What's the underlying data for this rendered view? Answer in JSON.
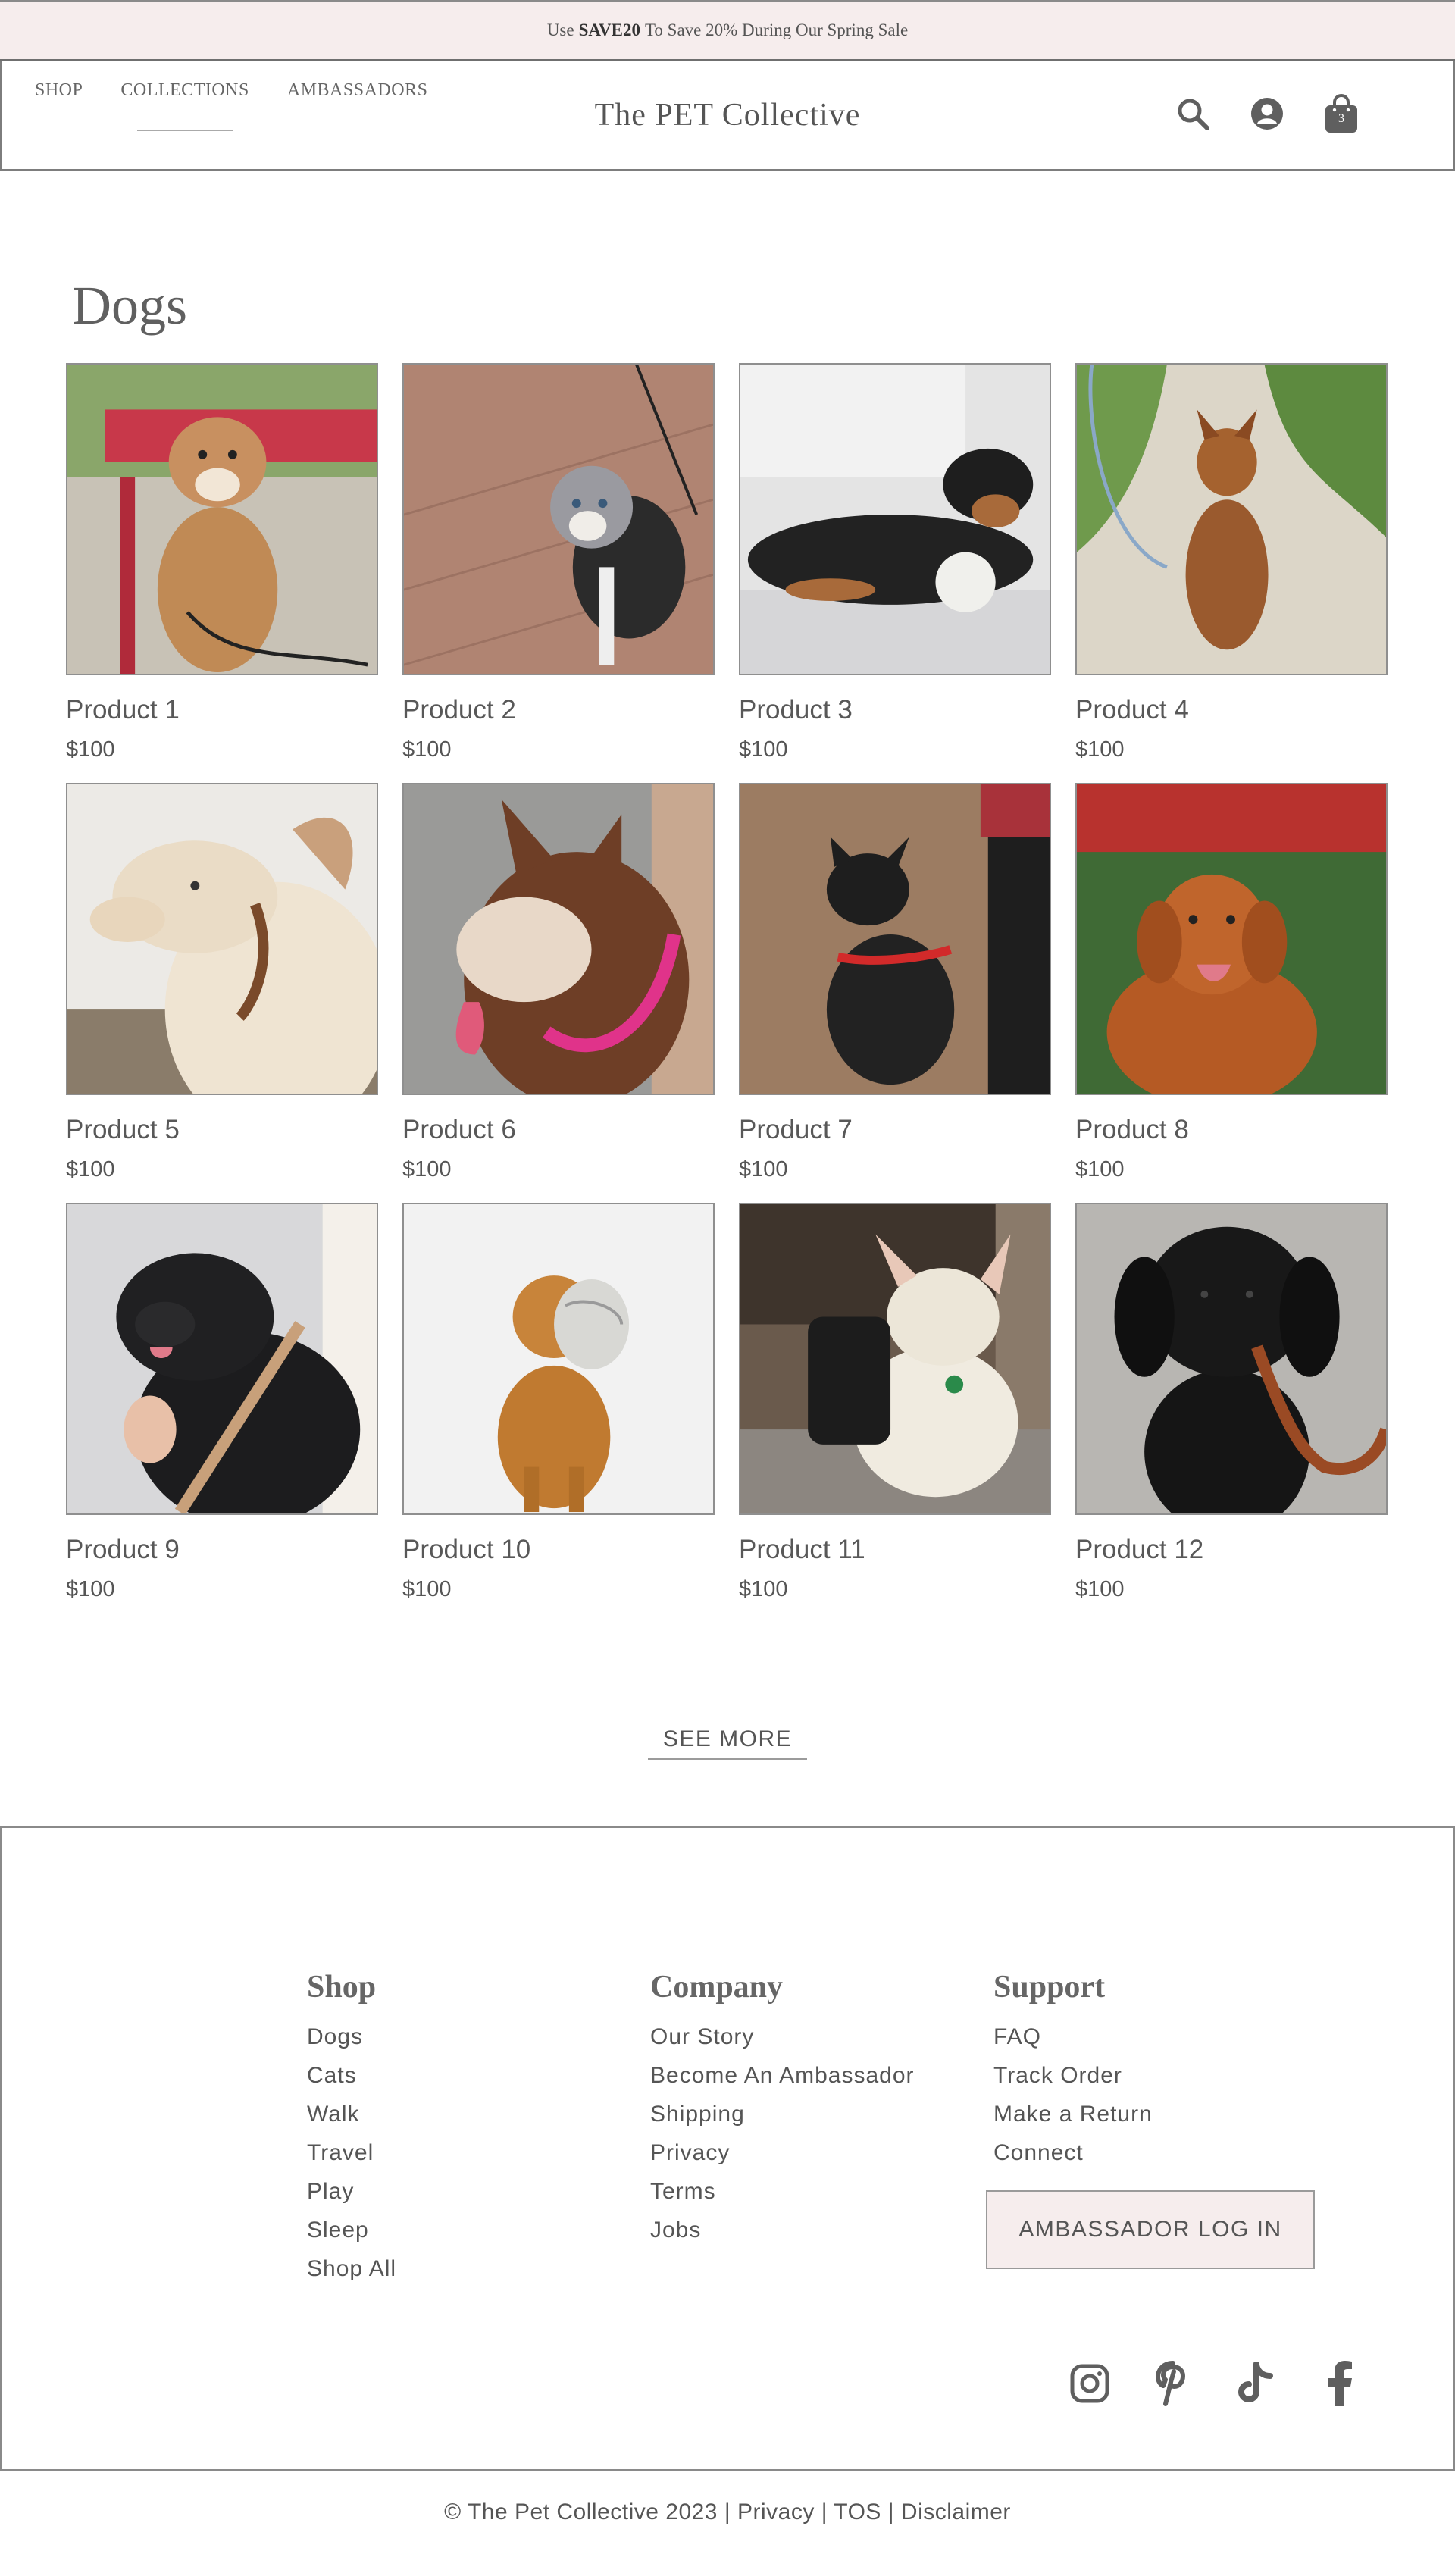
{
  "announcement": {
    "prefix": "Use",
    "code": "SAVE20",
    "suffix": "To Save 20% During Our Spring Sale"
  },
  "nav": {
    "items": [
      {
        "label": "SHOP"
      },
      {
        "label": "COLLECTIONS"
      },
      {
        "label": "AMBASSADORS"
      }
    ],
    "active": "COLLECTIONS"
  },
  "brand": "The PET Collective",
  "header_icons": [
    "search-icon",
    "account-icon",
    "cart-icon"
  ],
  "cart_count": "3",
  "page_title": "Dogs",
  "products": [
    {
      "name": "Product 1",
      "price": "$100"
    },
    {
      "name": "Product 2",
      "price": "$100"
    },
    {
      "name": "Product 3",
      "price": "$100"
    },
    {
      "name": "Product 4",
      "price": "$100"
    },
    {
      "name": "Product 5",
      "price": "$100"
    },
    {
      "name": "Product 6",
      "price": "$100"
    },
    {
      "name": "Product 7",
      "price": "$100"
    },
    {
      "name": "Product 8",
      "price": "$100"
    },
    {
      "name": "Product 9",
      "price": "$100"
    },
    {
      "name": "Product 10",
      "price": "$100"
    },
    {
      "name": "Product 11",
      "price": "$100"
    },
    {
      "name": "Product 12",
      "price": "$100"
    }
  ],
  "see_more": "SEE MORE",
  "footer": {
    "shop": {
      "title": "Shop",
      "links": [
        "Dogs",
        "Cats",
        "Walk",
        "Travel",
        "Play",
        "Sleep",
        "Shop All"
      ]
    },
    "company": {
      "title": "Company",
      "links": [
        "Our Story",
        "Become An Ambassador",
        "Shipping",
        "Privacy",
        "Terms",
        "Jobs"
      ]
    },
    "support": {
      "title": "Support",
      "links": [
        "FAQ",
        "Track Order",
        "Make a Return",
        "Connect"
      ]
    },
    "ambassador_button": "AMBASSADOR LOG IN",
    "socials": [
      "instagram-icon",
      "pinterest-icon",
      "tiktok-icon",
      "facebook-icon"
    ]
  },
  "copyright": {
    "text": "© The Pet Collective 2023",
    "links": [
      "Privacy",
      "TOS",
      "Disclaimer"
    ]
  },
  "colors": {
    "accent_bg": "#f6eded",
    "text": "#555555",
    "icon": "#5f5f5f",
    "border": "#8a8a8a"
  }
}
